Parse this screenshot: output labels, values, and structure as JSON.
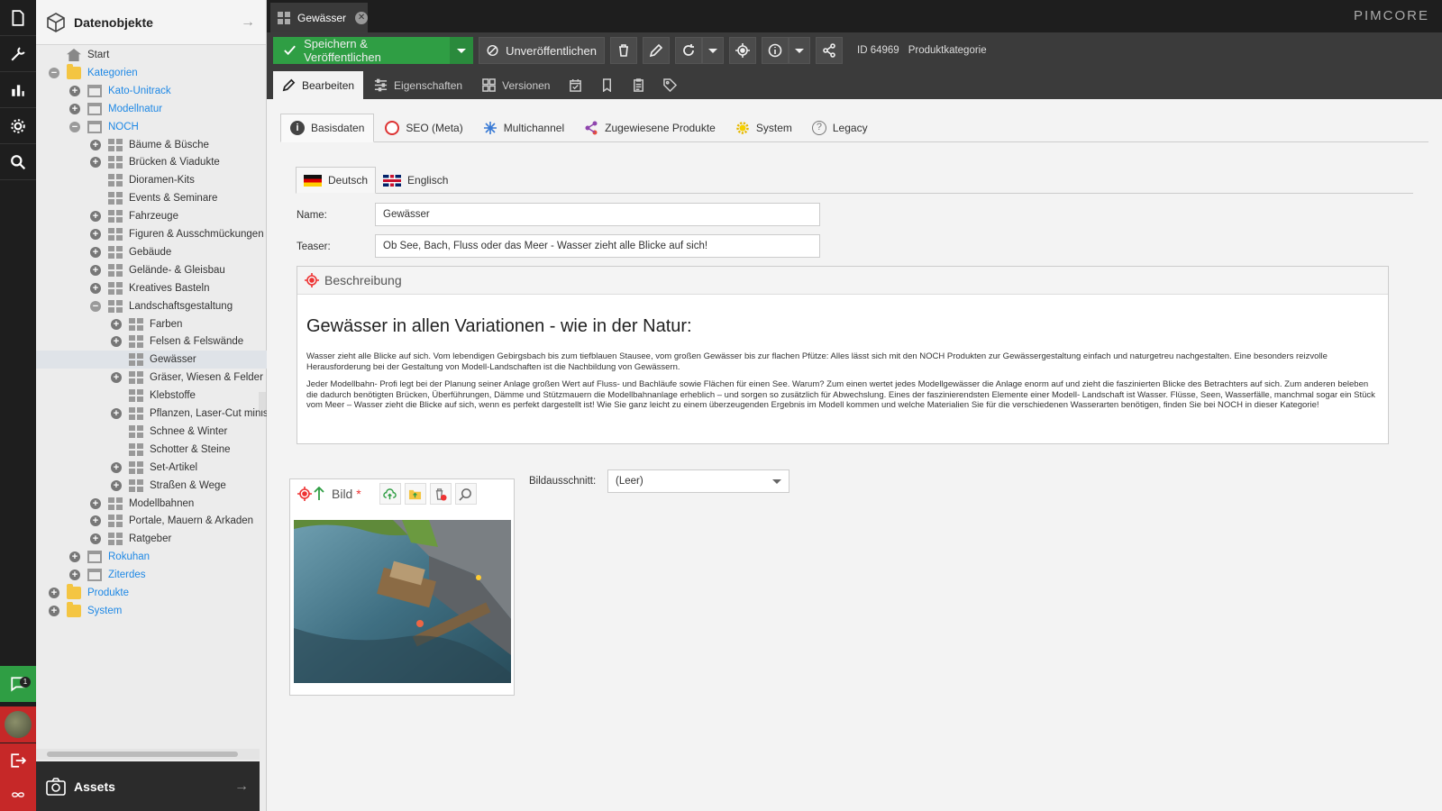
{
  "tree": {
    "title": "Datenobjekte",
    "footer_title": "Assets",
    "rows": [
      {
        "label": "Start",
        "icon": "home",
        "exp": "none",
        "indent": 0,
        "link": false
      },
      {
        "label": "Kategorien",
        "icon": "folder",
        "exp": "minus",
        "indent": 0,
        "link": true
      },
      {
        "label": "Kato-Unitrack",
        "icon": "shop",
        "exp": "plus",
        "indent": 1,
        "link": true
      },
      {
        "label": "Modellnatur",
        "icon": "shop",
        "exp": "plus",
        "indent": 1,
        "link": true
      },
      {
        "label": "NOCH",
        "icon": "shop",
        "exp": "minus",
        "indent": 1,
        "link": true
      },
      {
        "label": "Bäume & Büsche",
        "icon": "grid",
        "exp": "plus",
        "indent": 2,
        "link": false
      },
      {
        "label": "Brücken & Viadukte",
        "icon": "grid",
        "exp": "plus",
        "indent": 2,
        "link": false
      },
      {
        "label": "Dioramen-Kits",
        "icon": "grid",
        "exp": "none",
        "indent": 2,
        "link": false
      },
      {
        "label": "Events & Seminare",
        "icon": "grid",
        "exp": "none",
        "indent": 2,
        "link": false
      },
      {
        "label": "Fahrzeuge",
        "icon": "grid",
        "exp": "plus",
        "indent": 2,
        "link": false
      },
      {
        "label": "Figuren & Ausschmückungen",
        "icon": "grid",
        "exp": "plus",
        "indent": 2,
        "link": false
      },
      {
        "label": "Gebäude",
        "icon": "grid",
        "exp": "plus",
        "indent": 2,
        "link": false
      },
      {
        "label": "Gelände- & Gleisbau",
        "icon": "grid",
        "exp": "plus",
        "indent": 2,
        "link": false
      },
      {
        "label": "Kreatives Basteln",
        "icon": "grid",
        "exp": "plus",
        "indent": 2,
        "link": false
      },
      {
        "label": "Landschaftsgestaltung",
        "icon": "grid",
        "exp": "minus",
        "indent": 2,
        "link": false
      },
      {
        "label": "Farben",
        "icon": "grid",
        "exp": "plus",
        "indent": 3,
        "link": false
      },
      {
        "label": "Felsen & Felswände",
        "icon": "grid",
        "exp": "plus",
        "indent": 3,
        "link": false
      },
      {
        "label": "Gewässer",
        "icon": "grid",
        "exp": "none",
        "indent": 3,
        "link": false,
        "selected": true
      },
      {
        "label": "Gräser, Wiesen & Felder",
        "icon": "grid",
        "exp": "plus",
        "indent": 3,
        "link": false
      },
      {
        "label": "Klebstoffe",
        "icon": "grid",
        "exp": "none",
        "indent": 3,
        "link": false
      },
      {
        "label": "Pflanzen, Laser-Cut minis",
        "icon": "grid",
        "exp": "plus",
        "indent": 3,
        "link": false
      },
      {
        "label": "Schnee & Winter",
        "icon": "grid",
        "exp": "none",
        "indent": 3,
        "link": false
      },
      {
        "label": "Schotter & Steine",
        "icon": "grid",
        "exp": "none",
        "indent": 3,
        "link": false
      },
      {
        "label": "Set-Artikel",
        "icon": "grid",
        "exp": "plus",
        "indent": 3,
        "link": false
      },
      {
        "label": "Straßen & Wege",
        "icon": "grid",
        "exp": "plus",
        "indent": 3,
        "link": false
      },
      {
        "label": "Modellbahnen",
        "icon": "grid",
        "exp": "plus",
        "indent": 2,
        "link": false
      },
      {
        "label": "Portale, Mauern & Arkaden",
        "icon": "grid",
        "exp": "plus",
        "indent": 2,
        "link": false
      },
      {
        "label": "Ratgeber",
        "icon": "grid",
        "exp": "plus",
        "indent": 2,
        "link": false
      },
      {
        "label": "Rokuhan",
        "icon": "shop",
        "exp": "plus",
        "indent": 1,
        "link": true
      },
      {
        "label": "Ziterdes",
        "icon": "shop",
        "exp": "plus",
        "indent": 1,
        "link": true
      },
      {
        "label": "Produkte",
        "icon": "folder",
        "exp": "plus",
        "indent": 0,
        "link": true
      },
      {
        "label": "System",
        "icon": "folder",
        "exp": "plus",
        "indent": 0,
        "link": true
      }
    ]
  },
  "tab": {
    "label": "Gewässer"
  },
  "brand": "PIMCORE",
  "toolbar": {
    "save_label": "Speichern & Veröffentlichen",
    "unpublish_label": "Unveröffentlichen",
    "id_text": "ID 64969",
    "class_text": "Produktkategorie"
  },
  "subtabs": {
    "edit": "Bearbeiten",
    "properties": "Eigenschaften",
    "versions": "Versionen"
  },
  "panel_tabs": [
    "Basisdaten",
    "SEO (Meta)",
    "Multichannel",
    "Zugewiesene Produkte",
    "System",
    "Legacy"
  ],
  "lang_tabs": [
    "Deutsch",
    "Englisch"
  ],
  "form": {
    "name_label": "Name:",
    "name_value": "Gewässer",
    "teaser_label": "Teaser:",
    "teaser_value": "Ob See, Bach, Fluss oder das Meer - Wasser zieht alle Blicke auf sich!",
    "desc_label": "Beschreibung",
    "desc_heading": "Gewässer in allen Variationen - wie in der Natur:",
    "desc_p1": "Wasser zieht alle Blicke auf sich. Vom lebendigen Gebirgsbach bis zum tiefblauen Stausee, vom großen Gewässer bis zur flachen Pfütze: Alles lässt sich mit den NOCH Produkten zur Gewässergestaltung einfach und naturgetreu nachgestalten. Eine besonders reizvolle Herausforderung bei der Gestaltung von Modell-Landschaften ist die Nachbildung von Gewässern.",
    "desc_p2": "Jeder Modellbahn- Profi legt bei der Planung seiner Anlage großen Wert auf Fluss- und Bachläufe sowie Flächen für einen See. Warum? Zum einen wertet jedes Modellgewässer die Anlage enorm auf und zieht die faszinierten Blicke des Betrachters auf sich. Zum anderen beleben die dadurch benötigten Brücken, Überführungen, Dämme und Stützmauern die Modellbahnanlage erheblich – und sorgen so zusätzlich für Abwechslung. Eines der faszinierendsten Elemente einer Modell- Landschaft ist Wasser. Flüsse, Seen, Wasserfälle, manchmal sogar ein Stück vom Meer – Wasser zieht die Blicke auf sich, wenn es perfekt dargestellt ist! Wie Sie ganz leicht zu einem überzeugenden Ergebnis im Modell kommen und welche Materialien Sie für die verschiedenen Wasserarten benötigen, finden Sie bei NOCH in dieser Kategorie!",
    "image_label": "Bild",
    "image_required": "*",
    "crop_label": "Bildausschnitt:",
    "crop_value": "(Leer)"
  },
  "chat_badge": "1",
  "colors": {
    "accent_green": "#2f9e44",
    "link_blue": "#1e88e5",
    "danger_red": "#c62828"
  }
}
